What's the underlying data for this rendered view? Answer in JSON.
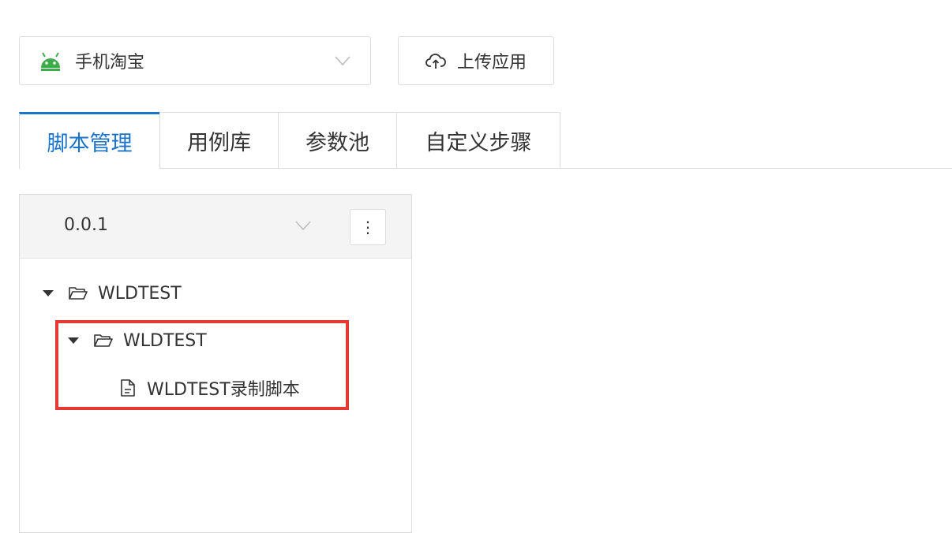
{
  "app_select": {
    "value": "手机淘宝",
    "icon": "android-icon",
    "icon_color": "#3dab49"
  },
  "upload_button": {
    "label": "上传应用",
    "icon": "cloud-upload-icon"
  },
  "tabs": [
    {
      "label": "脚本管理",
      "active": true
    },
    {
      "label": "用例库",
      "active": false
    },
    {
      "label": "参数池",
      "active": false
    },
    {
      "label": "自定义步骤",
      "active": false
    }
  ],
  "colors": {
    "accent": "#1a73c9",
    "highlight": "#e43a33"
  },
  "script_panel": {
    "version_select": {
      "value": "0.0.1"
    },
    "more_button": {
      "label": "⋮"
    },
    "tree": [
      {
        "label": "WLDTEST",
        "type": "folder",
        "expanded": true
      },
      {
        "label": "WLDTEST",
        "type": "folder",
        "expanded": true
      },
      {
        "label": "WLDTEST录制脚本",
        "type": "file"
      }
    ]
  }
}
